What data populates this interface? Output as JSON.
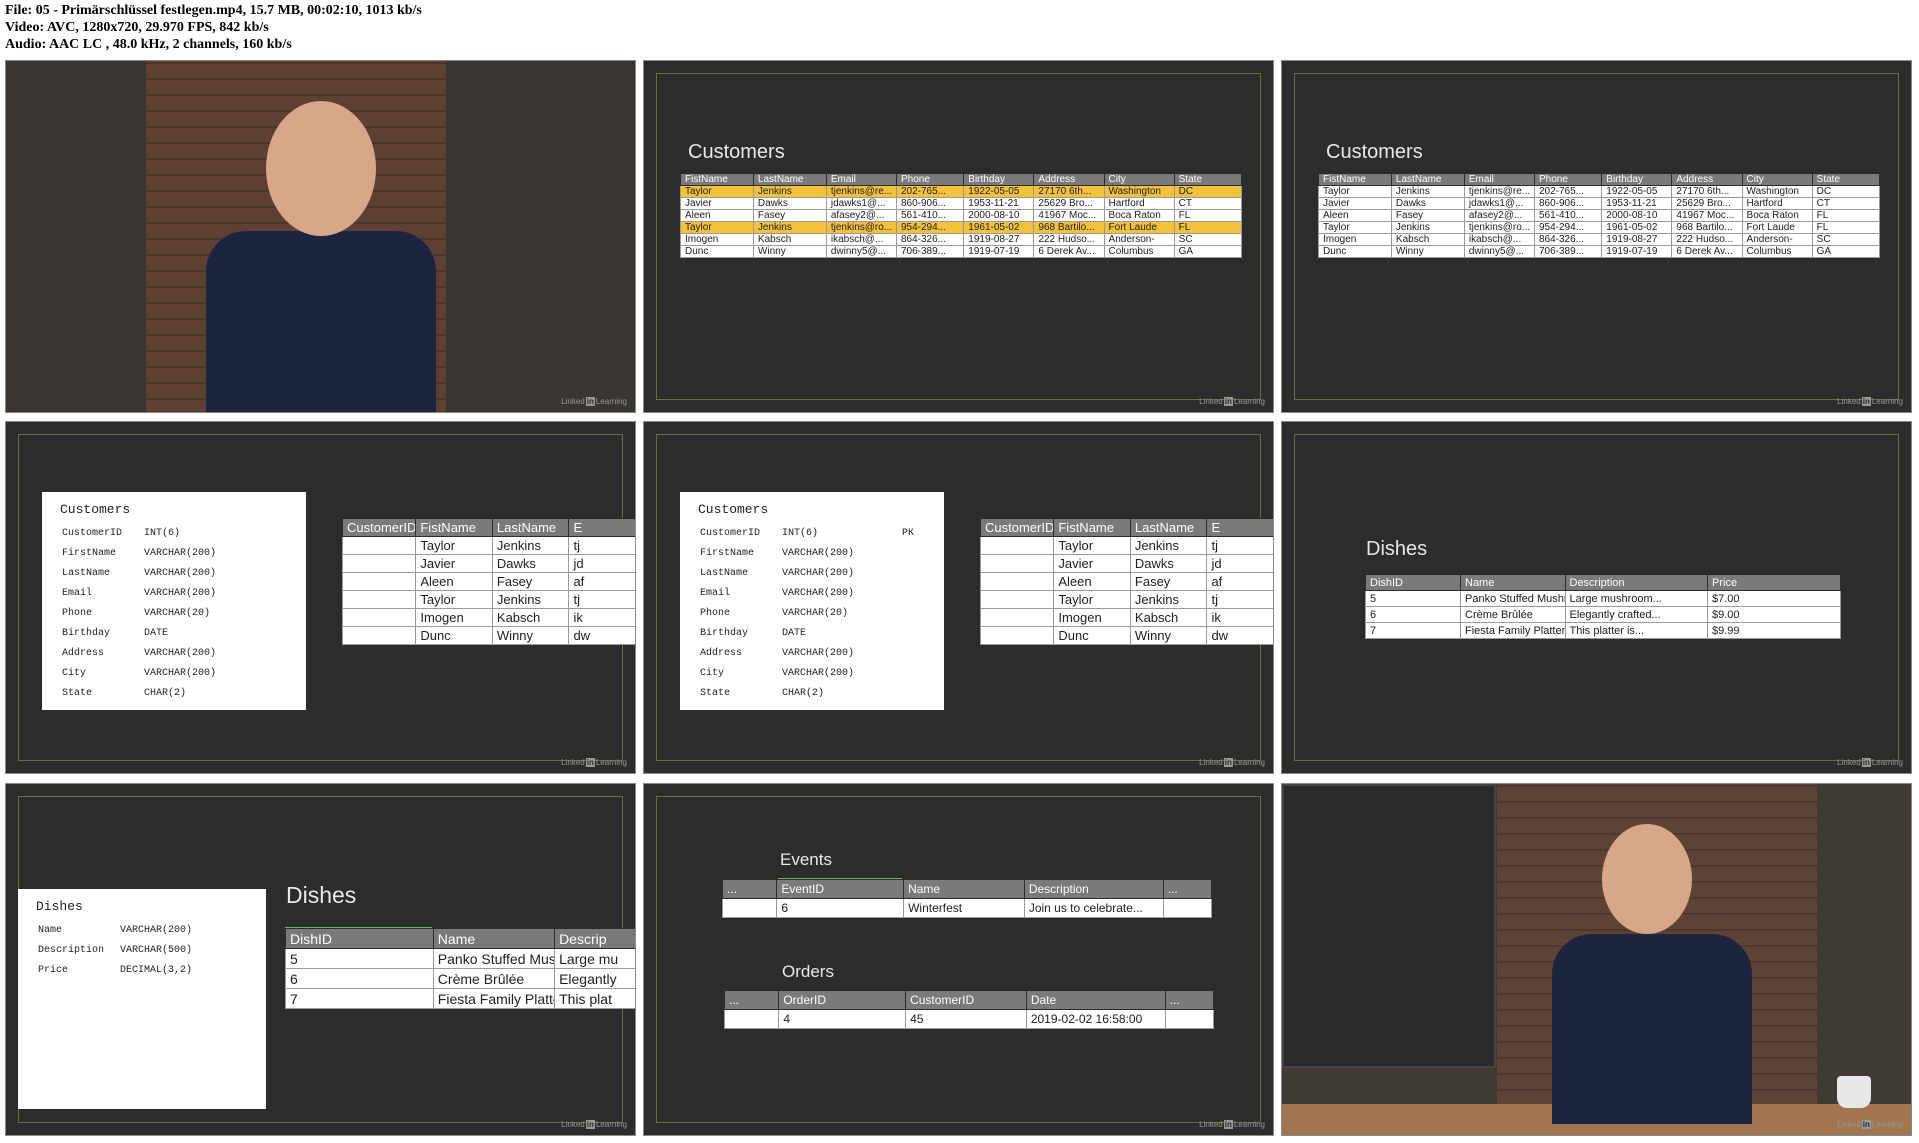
{
  "header": {
    "line1": "File: 05 - Primärschlüssel festlegen.mp4, 15.7 MB, 00:02:10, 1013 kb/s",
    "line2": "Video: AVC, 1280x720, 29.970 FPS, 842 kb/s",
    "line3": "Audio: AAC LC , 48.0 kHz, 2 channels, 160 kb/s"
  },
  "watermark": {
    "pre": "Linked",
    "in": "in",
    "post": "Learning"
  },
  "customers_title": "Customers",
  "customers_wide": {
    "columns": [
      "FistName",
      "LastName",
      "Email",
      "Phone",
      "Birthday",
      "Address",
      "City",
      "State"
    ],
    "rows": [
      [
        "Taylor",
        "Jenkins",
        "tjenkins@re...",
        "202-765...",
        "1922-05-05",
        "27170 6th...",
        "Washington",
        "DC"
      ],
      [
        "Javier",
        "Dawks",
        "jdawks1@...",
        "860-906...",
        "1953-11-21",
        "25629 Bro...",
        "Hartford",
        "CT"
      ],
      [
        "Aleen",
        "Fasey",
        "afasey2@...",
        "561-410...",
        "2000-08-10",
        "41967 Moc...",
        "Boca Raton",
        "FL"
      ],
      [
        "Taylor",
        "Jenkins",
        "tjenkins@ro...",
        "954-294...",
        "1961-05-02",
        "968 Bartilo...",
        "Fort Laude",
        "FL"
      ],
      [
        "Imogen",
        "Kabsch",
        "ikabsch@...",
        "864-326...",
        "1919-08-27",
        "222 Hudso...",
        "Anderson-",
        "SC"
      ],
      [
        "Dunc",
        "Winny",
        "dwinny5@...",
        "706-389...",
        "1919-07-19",
        "6 Derek Av...",
        "Columbus",
        "GA"
      ]
    ]
  },
  "customers_schema": {
    "title": "Customers",
    "fields": [
      {
        "name": "CustomerID",
        "type": "INT(6)",
        "pk": "PK"
      },
      {
        "name": "FirstName",
        "type": "VARCHAR(200)",
        "pk": ""
      },
      {
        "name": "LastName",
        "type": "VARCHAR(200)",
        "pk": ""
      },
      {
        "name": "Email",
        "type": "VARCHAR(200)",
        "pk": ""
      },
      {
        "name": "Phone",
        "type": "VARCHAR(20)",
        "pk": ""
      },
      {
        "name": "Birthday",
        "type": "DATE",
        "pk": ""
      },
      {
        "name": "Address",
        "type": "VARCHAR(200)",
        "pk": ""
      },
      {
        "name": "City",
        "type": "VARCHAR(200)",
        "pk": ""
      },
      {
        "name": "State",
        "type": "CHAR(2)",
        "pk": ""
      }
    ]
  },
  "customers_id_table": {
    "columns": [
      "CustomerID",
      "FistName",
      "LastName",
      "E"
    ],
    "rows": [
      [
        "",
        "Taylor",
        "Jenkins",
        "tj"
      ],
      [
        "",
        "Javier",
        "Dawks",
        "jd"
      ],
      [
        "",
        "Aleen",
        "Fasey",
        "af"
      ],
      [
        "",
        "Taylor",
        "Jenkins",
        "tj"
      ],
      [
        "",
        "Imogen",
        "Kabsch",
        "ik"
      ],
      [
        "",
        "Dunc",
        "Winny",
        "dw"
      ]
    ]
  },
  "dishes_title": "Dishes",
  "dishes_table": {
    "columns": [
      "DishID",
      "Name",
      "Description",
      "Price"
    ],
    "rows": [
      [
        "5",
        "Panko Stuffed Mushrooms",
        "Large mushroom...",
        "$7.00"
      ],
      [
        "6",
        "Crème Brûlée",
        "Elegantly crafted...",
        "$9.00"
      ],
      [
        "7",
        "Fiesta Family Platter",
        "This platter is...",
        "$9.99"
      ]
    ]
  },
  "dishes_schema": {
    "title": "Dishes",
    "fields": [
      {
        "name": "Name",
        "type": "VARCHAR(200)"
      },
      {
        "name": "Description",
        "type": "VARCHAR(500)"
      },
      {
        "name": "Price",
        "type": "DECIMAL(3,2)"
      }
    ]
  },
  "dishes_big": {
    "columns": [
      "DishID",
      "Name",
      "Descrip"
    ],
    "rows": [
      [
        "5",
        "Panko Stuffed Mushrooms",
        "Large mu"
      ],
      [
        "6",
        "Crème Brûlée",
        "Elegantly"
      ],
      [
        "7",
        "Fiesta Family Platter",
        "This plat"
      ]
    ]
  },
  "events": {
    "title": "Events",
    "columns": [
      "...",
      "EventID",
      "Name",
      "Description",
      "..."
    ],
    "row": [
      "",
      "6",
      "Winterfest",
      "Join us to celebrate...",
      ""
    ]
  },
  "orders": {
    "title": "Orders",
    "columns": [
      "...",
      "OrderID",
      "CustomerID",
      "Date",
      "..."
    ],
    "row": [
      "",
      "4",
      "45",
      "2019-02-02 16:58:00",
      ""
    ]
  }
}
